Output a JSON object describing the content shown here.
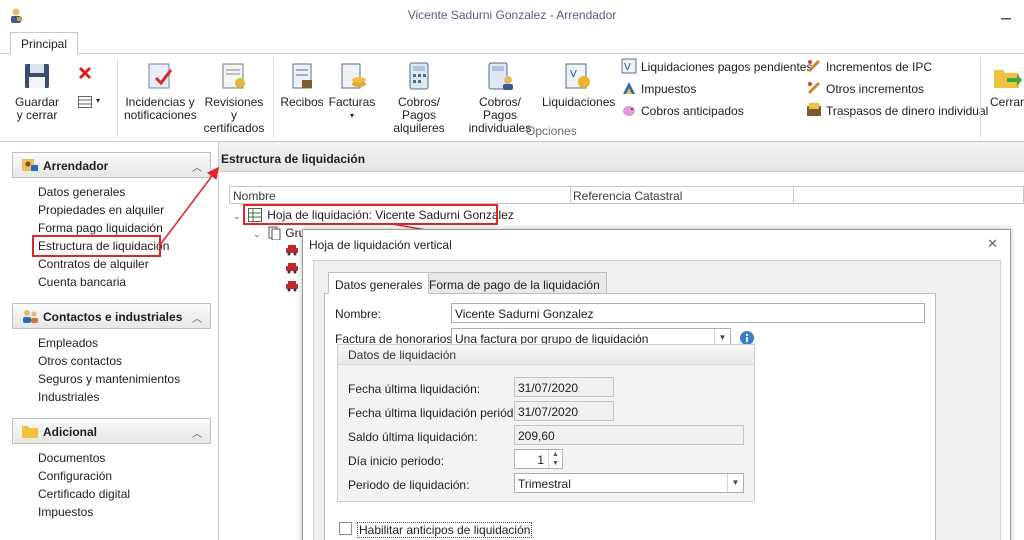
{
  "window": {
    "title": "Vicente Sadurni Gonzalez - Arrendador"
  },
  "ribbon": {
    "tab": "Principal",
    "guardar": {
      "line1": "Guardar",
      "line2": "y cerrar"
    },
    "incidencias": {
      "line1": "Incidencias y",
      "line2": "notificaciones"
    },
    "revisiones": {
      "line1": "Revisiones y",
      "line2": "certificados"
    },
    "recibos": "Recibos",
    "facturas": "Facturas",
    "cobros_alquileres": {
      "line1": "Cobros/ Pagos",
      "line2": "alquileres"
    },
    "cobros_individuales": {
      "line1": "Cobros/ Pagos",
      "line2": "individuales"
    },
    "liquidaciones": "Liquidaciones",
    "group_label": "Opciones",
    "small_col1": [
      "Liquidaciones pagos pendientes",
      "Impuestos",
      "Cobros anticipados"
    ],
    "small_col2": [
      "Incrementos de IPC",
      "Otros incrementos",
      "Traspasos de dinero individual"
    ],
    "cerrar": "Cerrar"
  },
  "sidebar": {
    "sections": [
      {
        "title": "Arrendador",
        "items": [
          "Datos generales",
          "Propiedades en alquiler",
          "Forma pago liquidación",
          "Estructura de liquidación",
          "Contratos de alquiler",
          "Cuenta bancaria"
        ]
      },
      {
        "title": "Contactos e industriales",
        "items": [
          "Empleados",
          "Otros contactos",
          "Seguros y mantenimientos",
          "Industriales"
        ]
      },
      {
        "title": "Adicional",
        "items": [
          "Documentos",
          "Configuración",
          "Certificado digital",
          "Impuestos"
        ]
      }
    ]
  },
  "main": {
    "title": "Estructura de liquidación",
    "columns": [
      "Nombre",
      "Referencia Catastral"
    ],
    "tree_root": "Hoja de liquidación: Vicente Sadurni Gonzalez",
    "tree_child": "Gru"
  },
  "dialog": {
    "title": "Hoja de liquidación vertical",
    "tabs": [
      "Datos generales",
      "Forma de pago de la liquidación"
    ],
    "nombre_label": "Nombre:",
    "nombre_value": "Vicente Sadurni Gonzalez",
    "factura_label": "Factura de honorarios:",
    "factura_value": "Una factura por grupo de liquidación",
    "group_title": "Datos de liquidación",
    "fields": [
      {
        "label": "Fecha última liquidación:",
        "value": "31/07/2020"
      },
      {
        "label": "Fecha última liquidación periódica:",
        "value": "31/07/2020"
      },
      {
        "label": "Saldo última liquidación:",
        "value": "209,60"
      },
      {
        "label": "Día inicio periodo:",
        "value": "1"
      },
      {
        "label": "Periodo de liquidación:",
        "value": "Trimestral"
      }
    ],
    "checkbox_label": "Habilitar anticipos de liquidación",
    "checkbox_checked": false
  },
  "colors": {
    "highlight": "#e0252b",
    "accent": "#2b6cb0"
  }
}
